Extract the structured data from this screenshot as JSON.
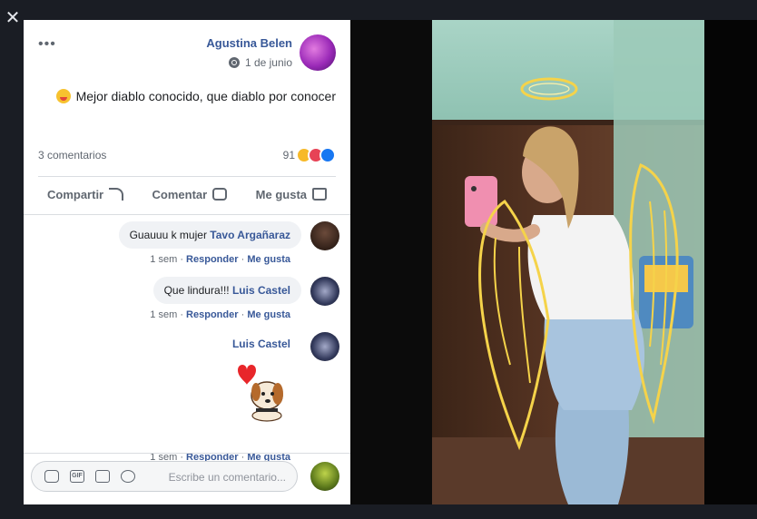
{
  "post": {
    "author": "Agustina Belen",
    "date": "1 de junio",
    "text": "Mejor diablo conocido, que diablo por conocer"
  },
  "stats": {
    "reactions_count": "91",
    "comments": "3 comentarios"
  },
  "actions": {
    "like": "Me gusta",
    "comment": "Comentar",
    "share": "Compartir"
  },
  "comments": [
    {
      "name": "Tavo Argañaraz",
      "text": "Guauuu k mujer",
      "like": "Me gusta",
      "reply": "Responder",
      "time": "1 sem"
    },
    {
      "name": "Luis Castel",
      "text": "Que lindura!!!",
      "like": "Me gusta",
      "reply": "Responder",
      "time": "1 sem"
    },
    {
      "name": "Luis Castel",
      "like": "Me gusta",
      "reply": "Responder",
      "time": "1 sem"
    }
  ],
  "composer": {
    "placeholder": "Escribe un comentario..."
  },
  "icons": {
    "close": "close-icon",
    "more": "more-options-icon",
    "privacy": "globe-icon",
    "like": "thumbs-up-icon",
    "comment": "speech-bubble-icon",
    "share": "share-arrow-icon",
    "emoji": "smiley-icon",
    "camera": "camera-icon",
    "gif": "gif-icon",
    "sticker": "sticker-icon"
  },
  "colors": {
    "link": "#385898",
    "like_blue": "#1877f2",
    "love_red": "#e74356",
    "haha_yellow": "#f7b928",
    "angel_gold": "#f5d34a"
  }
}
